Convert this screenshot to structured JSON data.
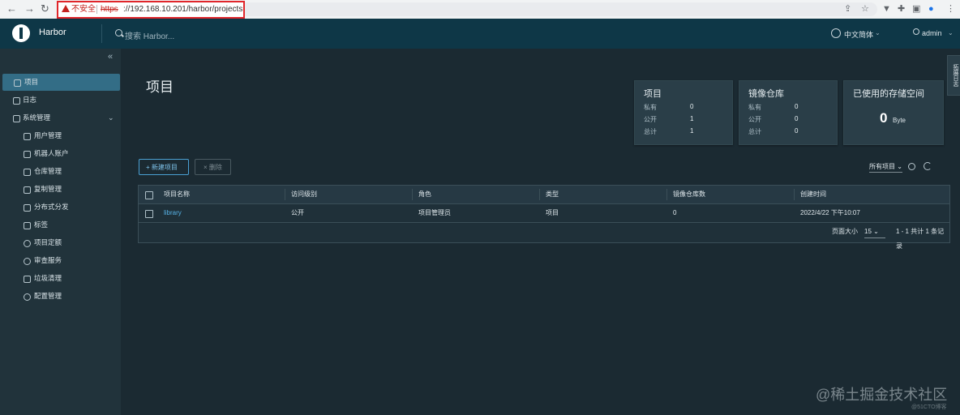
{
  "browser": {
    "back_icon": "arrow-left-icon",
    "forward_icon": "arrow-right-icon",
    "reload_icon": "reload-icon",
    "security_label": "不安全",
    "url_scheme": "https",
    "url_rest": "://192.168.10.201/harbor/projects"
  },
  "header": {
    "title": "Harbor",
    "search_placeholder": "搜索 Harbor...",
    "language": "中文简体",
    "user": "admin"
  },
  "sidebar": {
    "items": [
      {
        "label": "项目",
        "icon": "projects-icon",
        "active": true
      },
      {
        "label": "日志",
        "icon": "logs-icon"
      },
      {
        "label": "系统管理",
        "icon": "admin-icon"
      },
      {
        "label": "用户管理",
        "icon": "users-icon"
      },
      {
        "label": "机器人账户",
        "icon": "robot-icon"
      },
      {
        "label": "仓库管理",
        "icon": "registry-icon"
      },
      {
        "label": "复制管理",
        "icon": "replication-icon"
      },
      {
        "label": "分布式分发",
        "icon": "distribution-icon"
      },
      {
        "label": "标签",
        "icon": "tag-icon"
      },
      {
        "label": "项目定额",
        "icon": "quota-icon"
      },
      {
        "label": "审查服务",
        "icon": "scan-icon"
      },
      {
        "label": "垃圾清理",
        "icon": "trash-icon"
      },
      {
        "label": "配置管理",
        "icon": "settings-icon"
      }
    ]
  },
  "main": {
    "title": "项目",
    "cards": {
      "projects": {
        "title": "项目",
        "rows": [
          {
            "k": "私有",
            "v": "0"
          },
          {
            "k": "公开",
            "v": "1"
          },
          {
            "k": "总计",
            "v": "1"
          }
        ]
      },
      "repos": {
        "title": "镜像仓库",
        "rows": [
          {
            "k": "私有",
            "v": "0"
          },
          {
            "k": "公开",
            "v": "0"
          },
          {
            "k": "总计",
            "v": "0"
          }
        ]
      },
      "storage": {
        "title": "已使用的存储空间",
        "value": "0",
        "unit": "Byte"
      }
    },
    "new_project": "+ 新建项目",
    "delete": "× 删除",
    "filter": "所有项目",
    "table": {
      "headers": [
        "项目名称",
        "访问级别",
        "角色",
        "类型",
        "镜像仓库数",
        "创建时间"
      ],
      "rows": [
        [
          "library",
          "公开",
          "项目管理员",
          "项目",
          "0",
          "2022/4/22 下午10:07"
        ]
      ],
      "page_size_label": "页面大小",
      "page_size": "15",
      "summary": "1 - 1 共计 1 条记录"
    },
    "right_tab": "拓展日志"
  },
  "watermark": "@稀土掘金技术社区",
  "watermark2": "@51CTO博客"
}
